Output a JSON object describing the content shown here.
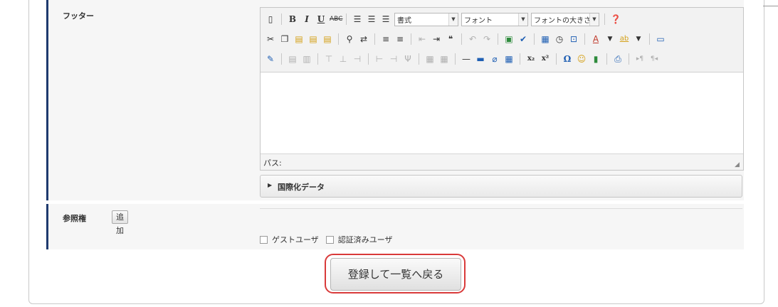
{
  "form": {
    "footer_label": "フッター",
    "ref_label": "参照権",
    "add_button": "追加",
    "i18n_label": "国際化データ",
    "path_label": "パス:",
    "checkboxes": [
      {
        "label": "ゲストユーザ",
        "checked": false
      },
      {
        "label": "認証済みユーザ",
        "checked": false
      }
    ],
    "submit_button": "登録して一覧へ戻る"
  },
  "toolbar": {
    "format_combo": "書式",
    "font_combo": "フォント",
    "size_combo": "フォントの大きさ",
    "abc_glyph": "ABC",
    "bold_glyph": "B",
    "italic_glyph": "I",
    "underline_glyph": "U",
    "text_color_glyph": "A",
    "bg_color_glyph": "ab",
    "subscript_glyph": "x₂",
    "superscript_glyph": "x²",
    "omega_glyph": "Ω"
  },
  "colors": {
    "accent_border": "#1e3a6e",
    "highlight": "#d93a3a"
  }
}
